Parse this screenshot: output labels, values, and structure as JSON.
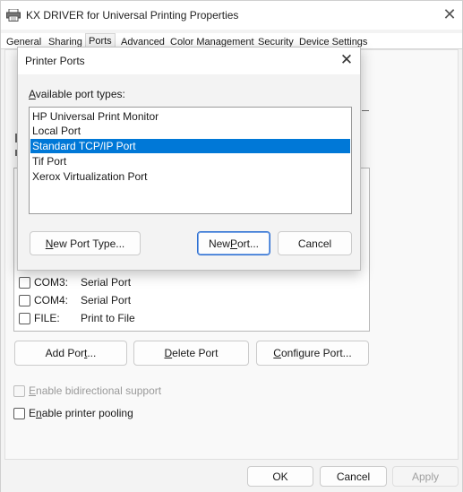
{
  "window": {
    "title": "KX DRIVER for Universal Printing Properties",
    "close_glyph": "✕"
  },
  "tabs": [
    {
      "label": "General"
    },
    {
      "label": "Sharing"
    },
    {
      "label": "Ports"
    },
    {
      "label": "Advanced"
    },
    {
      "label": "Color Management"
    },
    {
      "label": "Security"
    },
    {
      "label": "Device Settings"
    }
  ],
  "active_tab": "Ports",
  "ports": [
    {
      "name": "COM3:",
      "description": "Serial Port",
      "checked": false
    },
    {
      "name": "COM4:",
      "description": "Serial Port",
      "checked": false
    },
    {
      "name": "FILE:",
      "description": "Print to File",
      "checked": false
    }
  ],
  "port_buttons": {
    "add": {
      "pre": "Add Por",
      "ul": "t",
      "post": "..."
    },
    "delete": {
      "pre": "",
      "ul": "D",
      "post": "elete Port"
    },
    "configure": {
      "pre": "",
      "ul": "C",
      "post": "onfigure Port..."
    }
  },
  "options": {
    "bidirectional": {
      "ul": "E",
      "rest": "nable bidirectional support",
      "checked": false,
      "enabled": false
    },
    "pooling": {
      "pre": "E",
      "ul": "n",
      "rest": "able printer pooling",
      "checked": false,
      "enabled": true
    }
  },
  "dialog_buttons": {
    "ok": "OK",
    "cancel": "Cancel",
    "apply": "Apply"
  },
  "modal": {
    "title": "Printer Ports",
    "close_glyph": "✕",
    "label_ul": "A",
    "label_rest": "vailable port types:",
    "port_types": [
      {
        "label": "HP Universal Print Monitor",
        "selected": false
      },
      {
        "label": "Local Port",
        "selected": false
      },
      {
        "label": "Standard TCP/IP Port",
        "selected": true
      },
      {
        "label": "Tif Port",
        "selected": false
      },
      {
        "label": "Xerox Virtualization Port",
        "selected": false
      }
    ],
    "new_port_type": {
      "ul": "N",
      "rest": "ew Port Type..."
    },
    "new_port": {
      "pre": "New ",
      "ul": "P",
      "rest": "ort..."
    },
    "cancel": "Cancel"
  },
  "colors": {
    "selection": "#0078d7",
    "accent_border": "#2d6fd1"
  }
}
